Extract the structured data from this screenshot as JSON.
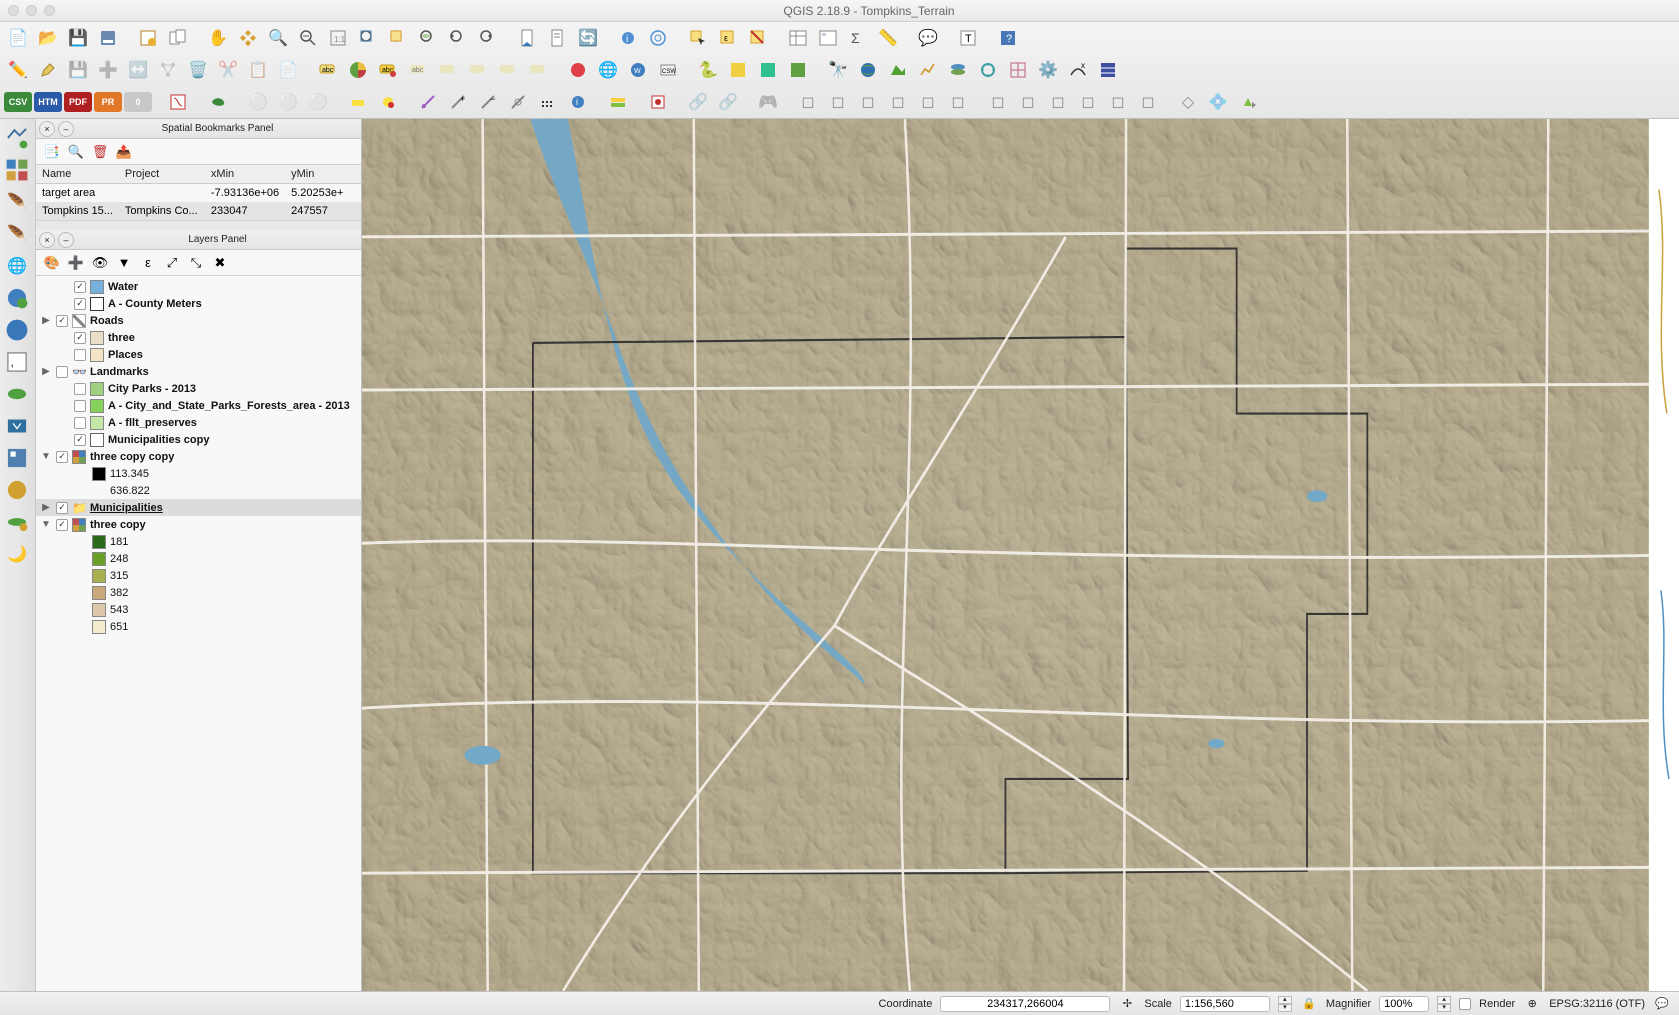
{
  "title": "QGIS 2.18.9 - Tompkins_Terrain",
  "export_pills": [
    "CSV",
    "HTM",
    "PDF",
    "PR",
    "0"
  ],
  "bookmarks_panel": {
    "title": "Spatial Bookmarks Panel",
    "columns": [
      "Name",
      "Project",
      "xMin",
      "yMin"
    ],
    "rows": [
      {
        "name": "target area",
        "project": "",
        "xmin": "-7.93136e+06",
        "ymin": "5.20253e+"
      },
      {
        "name": "Tompkins 15...",
        "project": "Tompkins Co...",
        "xmin": "233047",
        "ymin": "247557"
      }
    ]
  },
  "layers_panel": {
    "title": "Layers Panel",
    "layers": [
      {
        "kind": "layer",
        "indent": 1,
        "checked": true,
        "label": "Water",
        "bold": true,
        "color": "#78b0dc"
      },
      {
        "kind": "layer",
        "indent": 1,
        "checked": true,
        "label": "A - County Meters",
        "bold": true,
        "color": "#ffffff",
        "border": "#333"
      },
      {
        "kind": "group",
        "indent": 0,
        "twist": "▶",
        "checked": true,
        "label": "Roads",
        "bold": true,
        "roadsym": true
      },
      {
        "kind": "layer",
        "indent": 1,
        "checked": true,
        "label": "three",
        "bold": true,
        "color": "#eadfc6"
      },
      {
        "kind": "layer",
        "indent": 1,
        "checked": false,
        "label": "Places",
        "bold": true,
        "color": "#f2e4c4"
      },
      {
        "kind": "group",
        "indent": 0,
        "twist": "▶",
        "checked": false,
        "label": "Landmarks",
        "bold": true,
        "icon": "👓"
      },
      {
        "kind": "layer",
        "indent": 1,
        "checked": false,
        "label": "City Parks - 2013",
        "bold": true,
        "color": "#9ed080"
      },
      {
        "kind": "layer",
        "indent": 1,
        "checked": false,
        "label": "A  - City_and_State_Parks_Forests_area - 2013",
        "bold": true,
        "color": "#86d25a"
      },
      {
        "kind": "layer",
        "indent": 1,
        "checked": false,
        "label": "A - fllt_preserves",
        "bold": true,
        "color": "#c4e8a8"
      },
      {
        "kind": "layer",
        "indent": 1,
        "checked": true,
        "label": "Municipalities copy",
        "bold": true,
        "color": "#ffffff",
        "border": "#666"
      },
      {
        "kind": "group",
        "indent": 0,
        "twist": "▼",
        "checked": true,
        "label": "three copy copy",
        "bold": true,
        "raster": true
      },
      {
        "kind": "legend",
        "indent": 2,
        "label": "113.345",
        "color": "#000000"
      },
      {
        "kind": "legend",
        "indent": 2,
        "label": "636.822",
        "nosym": true
      },
      {
        "kind": "groupfolder",
        "indent": 0,
        "twist": "▶",
        "checked": true,
        "label": "Municipalities",
        "grp": true,
        "sel": true
      },
      {
        "kind": "group",
        "indent": 0,
        "twist": "▼",
        "checked": true,
        "label": "three copy",
        "bold": true,
        "raster": true
      },
      {
        "kind": "legend",
        "indent": 2,
        "label": "181",
        "color": "#2a6a1a"
      },
      {
        "kind": "legend",
        "indent": 2,
        "label": "248",
        "color": "#6aa028"
      },
      {
        "kind": "legend",
        "indent": 2,
        "label": "315",
        "color": "#a8b050"
      },
      {
        "kind": "legend",
        "indent": 2,
        "label": "382",
        "color": "#c8a878"
      },
      {
        "kind": "legend",
        "indent": 2,
        "label": "543",
        "color": "#dcc8a8"
      },
      {
        "kind": "legend",
        "indent": 2,
        "label": "651",
        "color": "#f4ead0"
      }
    ]
  },
  "statusbar": {
    "coord_label": "Coordinate",
    "coord_value": "234317,266004",
    "scale_label": "Scale",
    "scale_value": "1:156,560",
    "mag_label": "Magnifier",
    "mag_value": "100%",
    "render_label": "Render",
    "crs_label": "EPSG:32116 (OTF)"
  }
}
